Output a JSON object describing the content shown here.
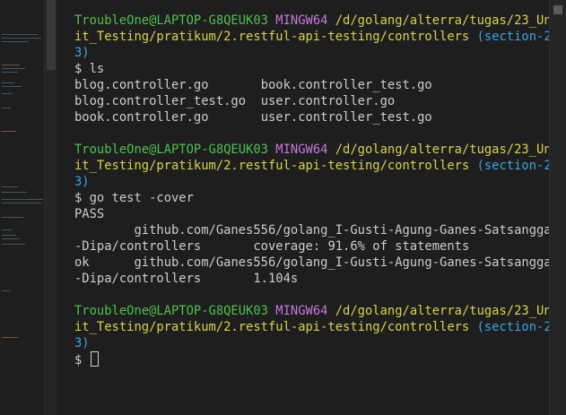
{
  "terminal": {
    "user_host": "TroubleOne@LAPTOP-G8QEUK03",
    "env": "MINGW64",
    "path_part1": "/d/golang/alterra/tugas/23_Un",
    "path_part2": "it_Testing/pratikum/2.restful-api-testing/controllers",
    "branch_part1": "(section-2",
    "branch_part2": "3)",
    "prompt": "$",
    "commands": {
      "ls": "ls",
      "test": "go test -cover"
    },
    "ls_output": {
      "row1_col1": "blog.controller.go",
      "row1_col2": "book.controller_test.go",
      "row2_col1": "blog.controller_test.go",
      "row2_col2": "user.controller.go",
      "row3_col1": "book.controller.go",
      "row3_col2": "user.controller_test.go"
    },
    "test_output": {
      "pass": "PASS",
      "line1": "github.com/Ganes556/golang_I-Gusti-Agung-Ganes-Satsangga",
      "line2_pkg": "-Dipa/controllers",
      "line2_cov": "coverage: 91.6% of statements",
      "ok": "ok",
      "line3": "github.com/Ganes556/golang_I-Gusti-Agung-Ganes-Satsangga",
      "line4_pkg": "-Dipa/controllers",
      "line4_time": "1.104s"
    }
  },
  "colors": {
    "user_host": "#4ec04e",
    "env": "#c678dd",
    "path": "#d7d34a",
    "branch": "#3aa4e0",
    "text": "#cccccc",
    "background": "#1e1e1e"
  }
}
